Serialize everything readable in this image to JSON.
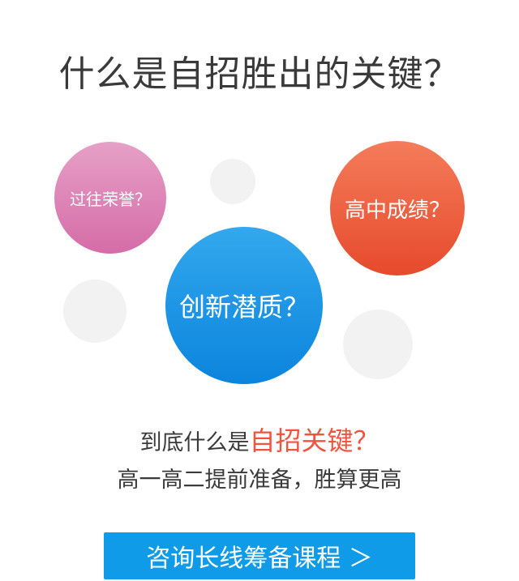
{
  "title": "什么是自招胜出的关键？",
  "bubbles": {
    "honors": "过往荣誉？",
    "scores": "高中成绩？",
    "innovation": "创新潜质？"
  },
  "subtitle": {
    "prefix": "到底什么是",
    "highlight": "自招关键？",
    "line2": "高一高二提前准备，胜算更高"
  },
  "cta": {
    "label": "咨询长线筹备课程 ＞"
  },
  "colors": {
    "pink": "#d56ca8",
    "orange": "#e64a2c",
    "blue": "#0b84dc",
    "accent_red": "#f0533f",
    "button": "#0f9be8"
  }
}
